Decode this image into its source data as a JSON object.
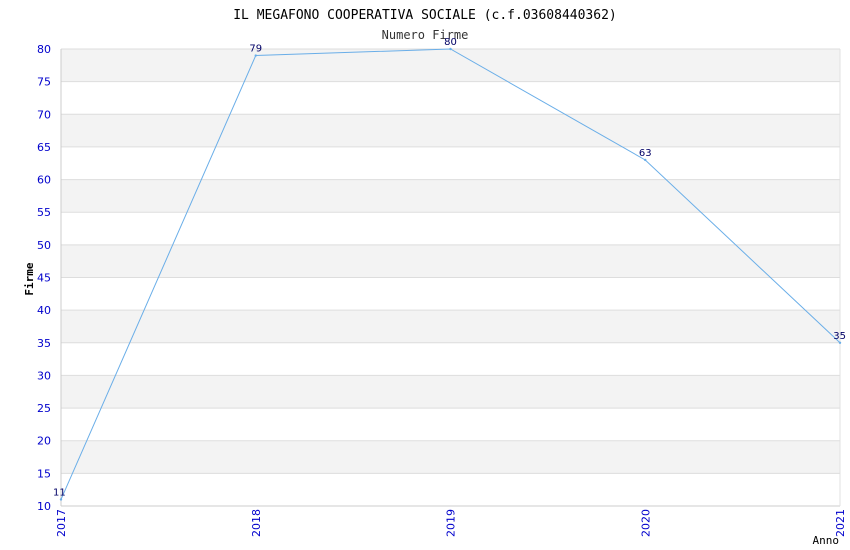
{
  "chart_data": {
    "type": "line",
    "title": "IL MEGAFONO COOPERATIVA SOCIALE (c.f.03608440362)",
    "subtitle": "Numero Firme",
    "xlabel": "Anno",
    "ylabel": "Firme",
    "categories": [
      "2017",
      "2018",
      "2019",
      "2020",
      "2021"
    ],
    "series": [
      {
        "values": [
          11,
          79,
          80,
          63,
          35
        ]
      }
    ],
    "ylim": [
      10,
      80
    ],
    "yticks": [
      10,
      15,
      20,
      25,
      30,
      35,
      40,
      45,
      50,
      55,
      60,
      65,
      70,
      75,
      80
    ],
    "grid": true,
    "data_labels": true,
    "colors": {
      "line": "#6aaee8",
      "tick_text": "#0000cc",
      "band": "#f3f3f3",
      "grid": "#dddddd",
      "label_text": "#000066",
      "title_text": "#000000"
    }
  }
}
